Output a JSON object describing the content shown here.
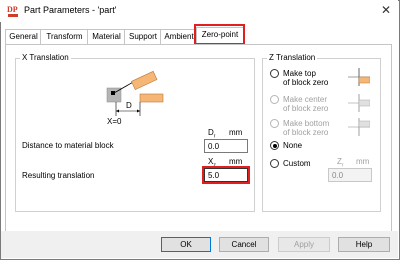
{
  "window": {
    "title": "Part Parameters - 'part'",
    "close_glyph": "✕",
    "logo_text": "DP"
  },
  "tabs": [
    {
      "label": "General"
    },
    {
      "label": "Transform"
    },
    {
      "label": "Material"
    },
    {
      "label": "Support"
    },
    {
      "label": "Ambient"
    },
    {
      "label": "Zero-point"
    }
  ],
  "selected_tab": "Zero-point",
  "x_translation": {
    "title": "X Translation",
    "diagram": {
      "d_label": "D",
      "x0_label": "X=0"
    },
    "distance": {
      "label": "Distance to material block",
      "var": "D",
      "sub": "r",
      "unit": "mm",
      "value": "0.0"
    },
    "resulting": {
      "label": "Resulting translation",
      "var": "X",
      "sub": "z",
      "unit": "mm",
      "value": "5.0"
    }
  },
  "z_translation": {
    "title": "Z Translation",
    "options": [
      {
        "line1": "Make top",
        "line2": "of block zero",
        "enabled": true,
        "checked": false
      },
      {
        "line1": "Make center",
        "line2": "of block zero",
        "enabled": false,
        "checked": false
      },
      {
        "line1": "Make bottom",
        "line2": "of block zero",
        "enabled": false,
        "checked": false
      },
      {
        "line1": "None",
        "line2": "",
        "enabled": true,
        "checked": true
      },
      {
        "line1": "Custom",
        "line2": "",
        "enabled": true,
        "checked": false
      }
    ],
    "custom": {
      "var": "Z",
      "sub": "r",
      "unit": "mm",
      "value": "0.0"
    }
  },
  "buttons": {
    "ok": "OK",
    "cancel": "Cancel",
    "apply": "Apply",
    "help": "Help"
  },
  "colors": {
    "accent_orange": "#f5b676",
    "highlight_red": "#e02020",
    "focus_blue": "#0078d7"
  }
}
